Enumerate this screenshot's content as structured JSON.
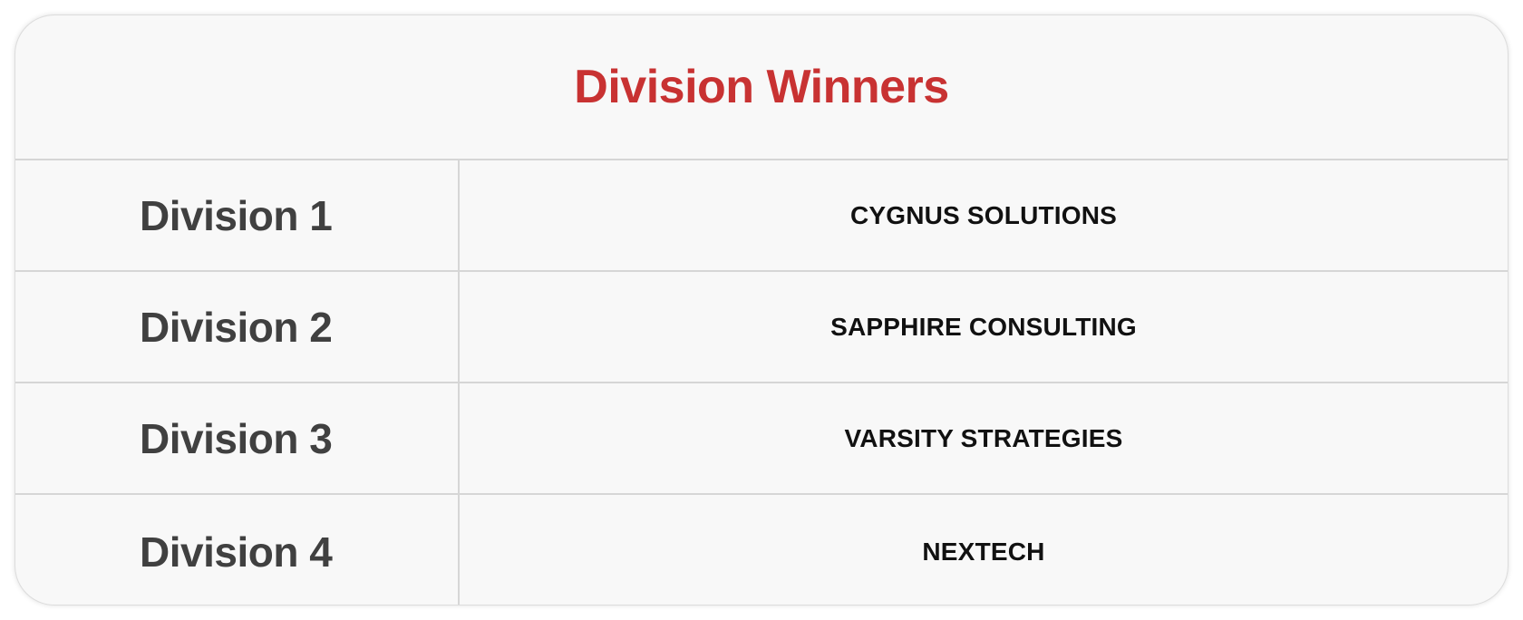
{
  "title": "Division Winners",
  "colors": {
    "title": "#c83232",
    "division_label": "#404040",
    "winner_text": "#111111",
    "background": "#f8f8f8",
    "border": "#d6d6d6"
  },
  "rows": [
    {
      "division": "Division 1",
      "winner": "CYGNUS SOLUTIONS"
    },
    {
      "division": "Division 2",
      "winner": "SAPPHIRE CONSULTING"
    },
    {
      "division": "Division 3",
      "winner": "VARSITY STRATEGIES"
    },
    {
      "division": "Division 4",
      "winner": "NEXTECH"
    }
  ]
}
